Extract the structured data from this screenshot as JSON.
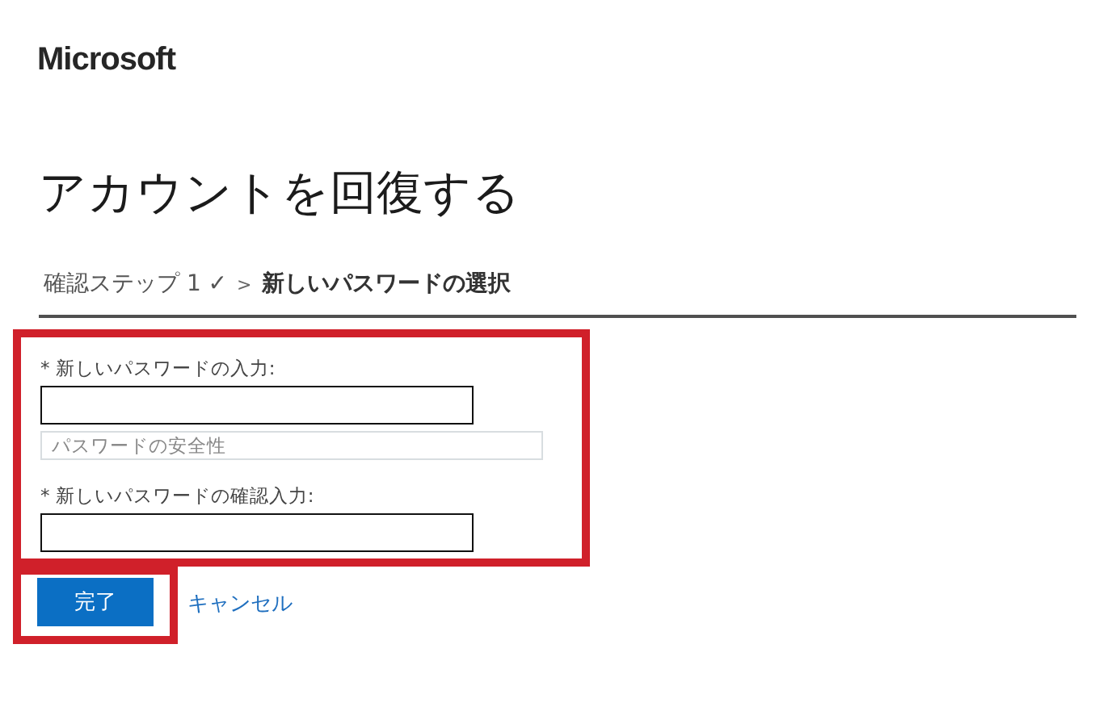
{
  "logo": "Microsoft",
  "heading": "アカウントを回復する",
  "breadcrumb": {
    "separator": ">",
    "steps": [
      {
        "label": "確認ステップ 1 ✓",
        "selected": false
      },
      {
        "label": "新しいパスワードの選択",
        "selected": true
      }
    ]
  },
  "form": {
    "highlighted": true,
    "fields": [
      {
        "label": "* 新しいパスワードの入力:",
        "strength": "パスワードの安全性"
      },
      {
        "label": "* 新しいパスワードの確認入力:"
      }
    ]
  },
  "submit": {
    "label": "完了",
    "highlighted": true
  },
  "cancel": "キャンセル"
}
